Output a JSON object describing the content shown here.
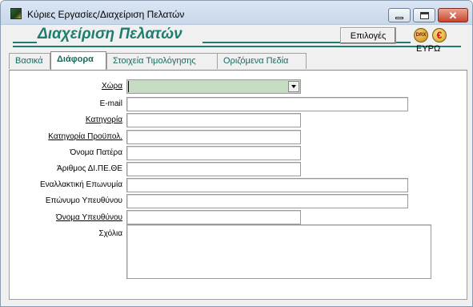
{
  "window": {
    "title": "Κύριες Εργασίες/Διαχείριση Πελατών",
    "controls": {
      "minimize_icon": "minimize-icon",
      "maximize_icon": "maximize-icon",
      "close_icon": "close-icon",
      "close_glyph": "✕"
    }
  },
  "header": {
    "title": "Διαχείριση Πελατών",
    "options_button": "Επιλογές",
    "drx_icon_text": "DRX",
    "euro_icon_text": "€",
    "currency_label": "ΕΥΡΩ",
    "accent_color": "#1f7d6f"
  },
  "tabs": [
    {
      "label": "Βασικά",
      "active": false
    },
    {
      "label": "Διάφορα",
      "active": true
    },
    {
      "label": "Στοιχεία Τιμολόγησης",
      "active": false
    },
    {
      "label": "Οριζόμενα Πεδία",
      "active": false
    }
  ],
  "form": {
    "country": {
      "label": "Χώρα",
      "value": ""
    },
    "email": {
      "label": "E-mail",
      "value": ""
    },
    "category": {
      "label": "Κατηγορία",
      "value": ""
    },
    "budget_category": {
      "label": "Κατηγορία Προϋπολ.",
      "value": ""
    },
    "father_name": {
      "label": "Όνομα Πατέρα",
      "value": ""
    },
    "dipethe_number": {
      "label": "Άριθμος ΔΙ.ΠΕ.ΘΕ",
      "value": ""
    },
    "alt_company_name": {
      "label": "Εναλλακτική Επωνυμία",
      "value": ""
    },
    "contact_surname": {
      "label": "Επώνυμο Υπευθύνου",
      "value": ""
    },
    "contact_name": {
      "label": "Όνομα Υπευθύνου",
      "value": ""
    },
    "comments": {
      "label": "Σχόλια",
      "value": ""
    }
  }
}
